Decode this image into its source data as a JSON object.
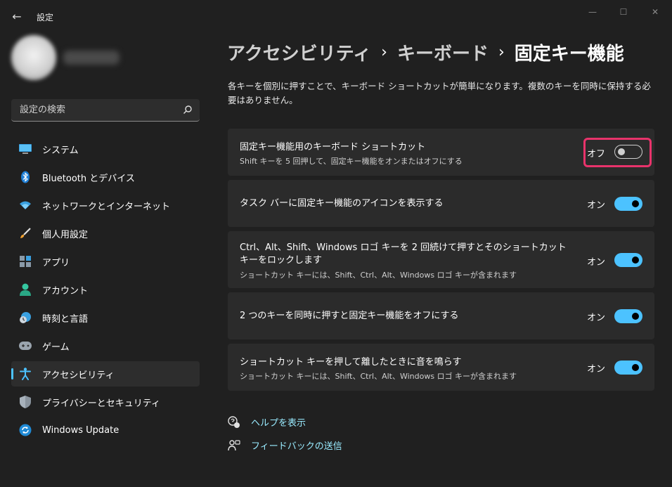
{
  "window": {
    "title": "設定",
    "back_icon": "←",
    "minimize_icon": "—",
    "maximize_icon": "☐",
    "close_icon": "✕"
  },
  "search": {
    "placeholder": "設定の検索"
  },
  "sidebar": {
    "items": [
      {
        "label": "システム",
        "icon": "system-icon"
      },
      {
        "label": "Bluetooth とデバイス",
        "icon": "bluetooth-icon"
      },
      {
        "label": "ネットワークとインターネット",
        "icon": "network-icon"
      },
      {
        "label": "個人用設定",
        "icon": "brush-icon"
      },
      {
        "label": "アプリ",
        "icon": "apps-icon"
      },
      {
        "label": "アカウント",
        "icon": "account-icon"
      },
      {
        "label": "時刻と言語",
        "icon": "time-language-icon"
      },
      {
        "label": "ゲーム",
        "icon": "gamepad-icon"
      },
      {
        "label": "アクセシビリティ",
        "icon": "accessibility-icon",
        "active": true
      },
      {
        "label": "プライバシーとセキュリティ",
        "icon": "shield-icon"
      },
      {
        "label": "Windows Update",
        "icon": "update-icon"
      }
    ]
  },
  "breadcrumb": {
    "level1": "アクセシビリティ",
    "level2": "キーボード",
    "current": "固定キー機能",
    "separator": "›"
  },
  "description": "各キーを個別に押すことで、キーボード ショートカットが簡単になります。複数のキーを同時に保持する必要はありません。",
  "settings": [
    {
      "title": "固定キー機能用のキーボード ショートカット",
      "subtitle": "Shift キーを 5 回押して、固定キー機能をオンまたはオフにする",
      "state_label": "オフ",
      "on": false
    },
    {
      "title": "タスク バーに固定キー機能のアイコンを表示する",
      "subtitle": "",
      "state_label": "オン",
      "on": true
    },
    {
      "title": "Ctrl、Alt、Shift、Windows ロゴ キーを 2 回続けて押すとそのショートカット",
      "title_line2": "キーをロックします",
      "subtitle": "ショートカット キーには、Shift、Ctrl、Alt、Windows ロゴ キーが含まれます",
      "state_label": "オン",
      "on": true
    },
    {
      "title": "2 つのキーを同時に押すと固定キー機能をオフにする",
      "subtitle": "",
      "state_label": "オン",
      "on": true
    },
    {
      "title": "ショートカット キーを押して離したときに音を鳴らす",
      "subtitle": "ショートカット キーには、Shift、Ctrl、Alt、Windows ロゴ キーが含まれます",
      "state_label": "オン",
      "on": true
    }
  ],
  "links": {
    "help": "ヘルプを表示",
    "feedback": "フィードバックの送信"
  },
  "colors": {
    "accent": "#4cc2ff",
    "link": "#99ebff",
    "highlight": "#e8336b",
    "card": "#2b2b2b",
    "background": "#202020"
  }
}
